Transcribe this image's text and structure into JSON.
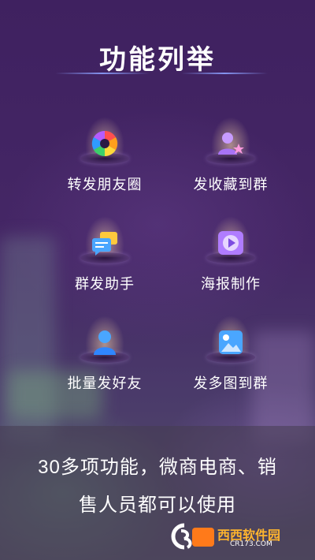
{
  "header": {
    "title": "功能列举"
  },
  "features": [
    {
      "label": "转发朋友圈",
      "icon": "aperture-icon"
    },
    {
      "label": "发收藏到群",
      "icon": "user-star-icon"
    },
    {
      "label": "群发助手",
      "icon": "chat-bubbles-icon"
    },
    {
      "label": "海报制作",
      "icon": "video-play-icon"
    },
    {
      "label": "批量发好友",
      "icon": "person-icon"
    },
    {
      "label": "发多图到群",
      "icon": "image-icon"
    }
  ],
  "footer": {
    "line1": "30多项功能，微商电商、销",
    "line2": "售人员都可以使用"
  },
  "watermark": {
    "brand": "西西软件园",
    "url": "CR173.COM"
  },
  "colors": {
    "background": "#3f2160",
    "text": "#ffffff",
    "watermark": "#ffb52e"
  }
}
